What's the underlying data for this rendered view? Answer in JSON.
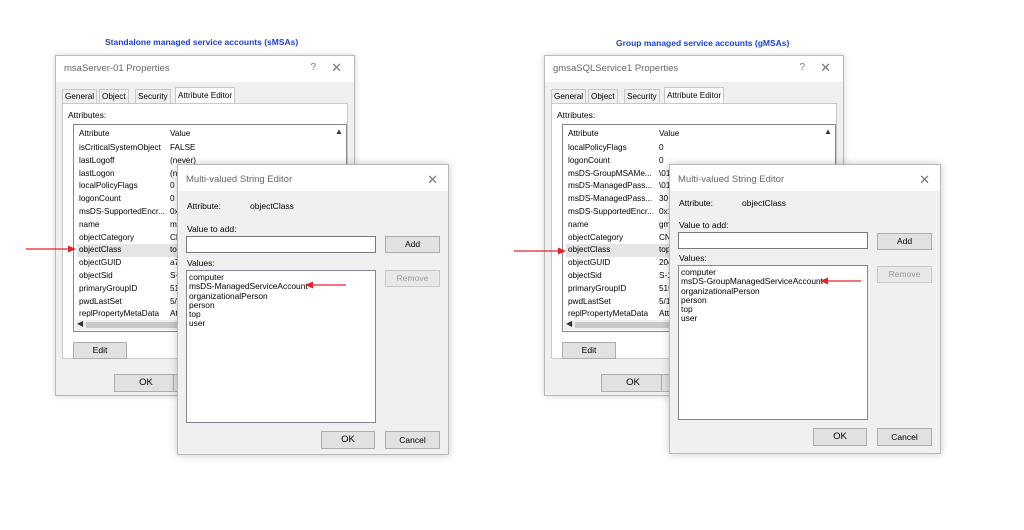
{
  "left": {
    "heading": "Standalone managed service accounts (sMSAs)",
    "props": {
      "title": "msaServer-01 Properties",
      "help_glyph": "?",
      "close_glyph": "✕",
      "tabs": [
        "General",
        "Object",
        "Security",
        "Attribute Editor"
      ],
      "attributes_label": "Attributes:",
      "col_attribute": "Attribute",
      "col_value": "Value",
      "rows": [
        {
          "attr": "isCriticalSystemObject",
          "val": "FALSE"
        },
        {
          "attr": "lastLogoff",
          "val": "(never)"
        },
        {
          "attr": "lastLogon",
          "val": "(ne"
        },
        {
          "attr": "localPolicyFlags",
          "val": "0"
        },
        {
          "attr": "logonCount",
          "val": "0"
        },
        {
          "attr": "msDS-SupportedEncr...",
          "val": "0x"
        },
        {
          "attr": "name",
          "val": "ms"
        },
        {
          "attr": "objectCategory",
          "val": "CN"
        },
        {
          "attr": "objectClass",
          "val": "top"
        },
        {
          "attr": "objectGUID",
          "val": "a7"
        },
        {
          "attr": "objectSid",
          "val": "S-1"
        },
        {
          "attr": "primaryGroupID",
          "val": "51"
        },
        {
          "attr": "pwdLastSet",
          "val": "5/"
        },
        {
          "attr": "replPropertyMetaData",
          "val": "At"
        }
      ],
      "edit_label": "Edit",
      "ok_label": "OK"
    },
    "editor": {
      "title": "Multi-valued String Editor",
      "close_glyph": "✕",
      "attribute_label": "Attribute:",
      "attribute_value": "objectClass",
      "value_to_add_label": "Value to add:",
      "add_label": "Add",
      "values_label": "Values:",
      "remove_label": "Remove",
      "values": [
        "computer",
        "msDS-ManagedServiceAccount",
        "organizationalPerson",
        "person",
        "top",
        "user"
      ],
      "ok_label": "OK",
      "cancel_label": "Cancel"
    }
  },
  "right": {
    "heading": "Group managed service accounts (gMSAs)",
    "props": {
      "title": "gmsaSQLService1 Properties",
      "help_glyph": "?",
      "close_glyph": "✕",
      "tabs": [
        "General",
        "Object",
        "Security",
        "Attribute Editor"
      ],
      "attributes_label": "Attributes:",
      "col_attribute": "Attribute",
      "col_value": "Value",
      "rows": [
        {
          "attr": "localPolicyFlags",
          "val": "0"
        },
        {
          "attr": "logonCount",
          "val": "0"
        },
        {
          "attr": "msDS-GroupMSAMe...",
          "val": "\\01"
        },
        {
          "attr": "msDS-ManagedPass...",
          "val": "\\01"
        },
        {
          "attr": "msDS-ManagedPass...",
          "val": "30"
        },
        {
          "attr": "msDS-SupportedEncr...",
          "val": "0x1"
        },
        {
          "attr": "name",
          "val": "gms"
        },
        {
          "attr": "objectCategory",
          "val": "CN="
        },
        {
          "attr": "objectClass",
          "val": "top;"
        },
        {
          "attr": "objectGUID",
          "val": "20e"
        },
        {
          "attr": "objectSid",
          "val": "S-1-"
        },
        {
          "attr": "primaryGroupID",
          "val": "515"
        },
        {
          "attr": "pwdLastSet",
          "val": "5/1"
        },
        {
          "attr": "replPropertyMetaData",
          "val": "Att"
        }
      ],
      "edit_label": "Edit",
      "ok_label": "OK"
    },
    "editor": {
      "title": "Multi-valued String Editor",
      "close_glyph": "✕",
      "attribute_label": "Attribute:",
      "attribute_value": "objectClass",
      "value_to_add_label": "Value to add:",
      "add_label": "Add",
      "values_label": "Values:",
      "remove_label": "Remove",
      "values": [
        "computer",
        "msDS-GroupManagedServiceAccount",
        "organizationalPerson",
        "person",
        "top",
        "user"
      ],
      "ok_label": "OK",
      "cancel_label": "Cancel"
    }
  },
  "colors": {
    "heading": "#1c3fd0",
    "arrow": "#e3232c"
  }
}
